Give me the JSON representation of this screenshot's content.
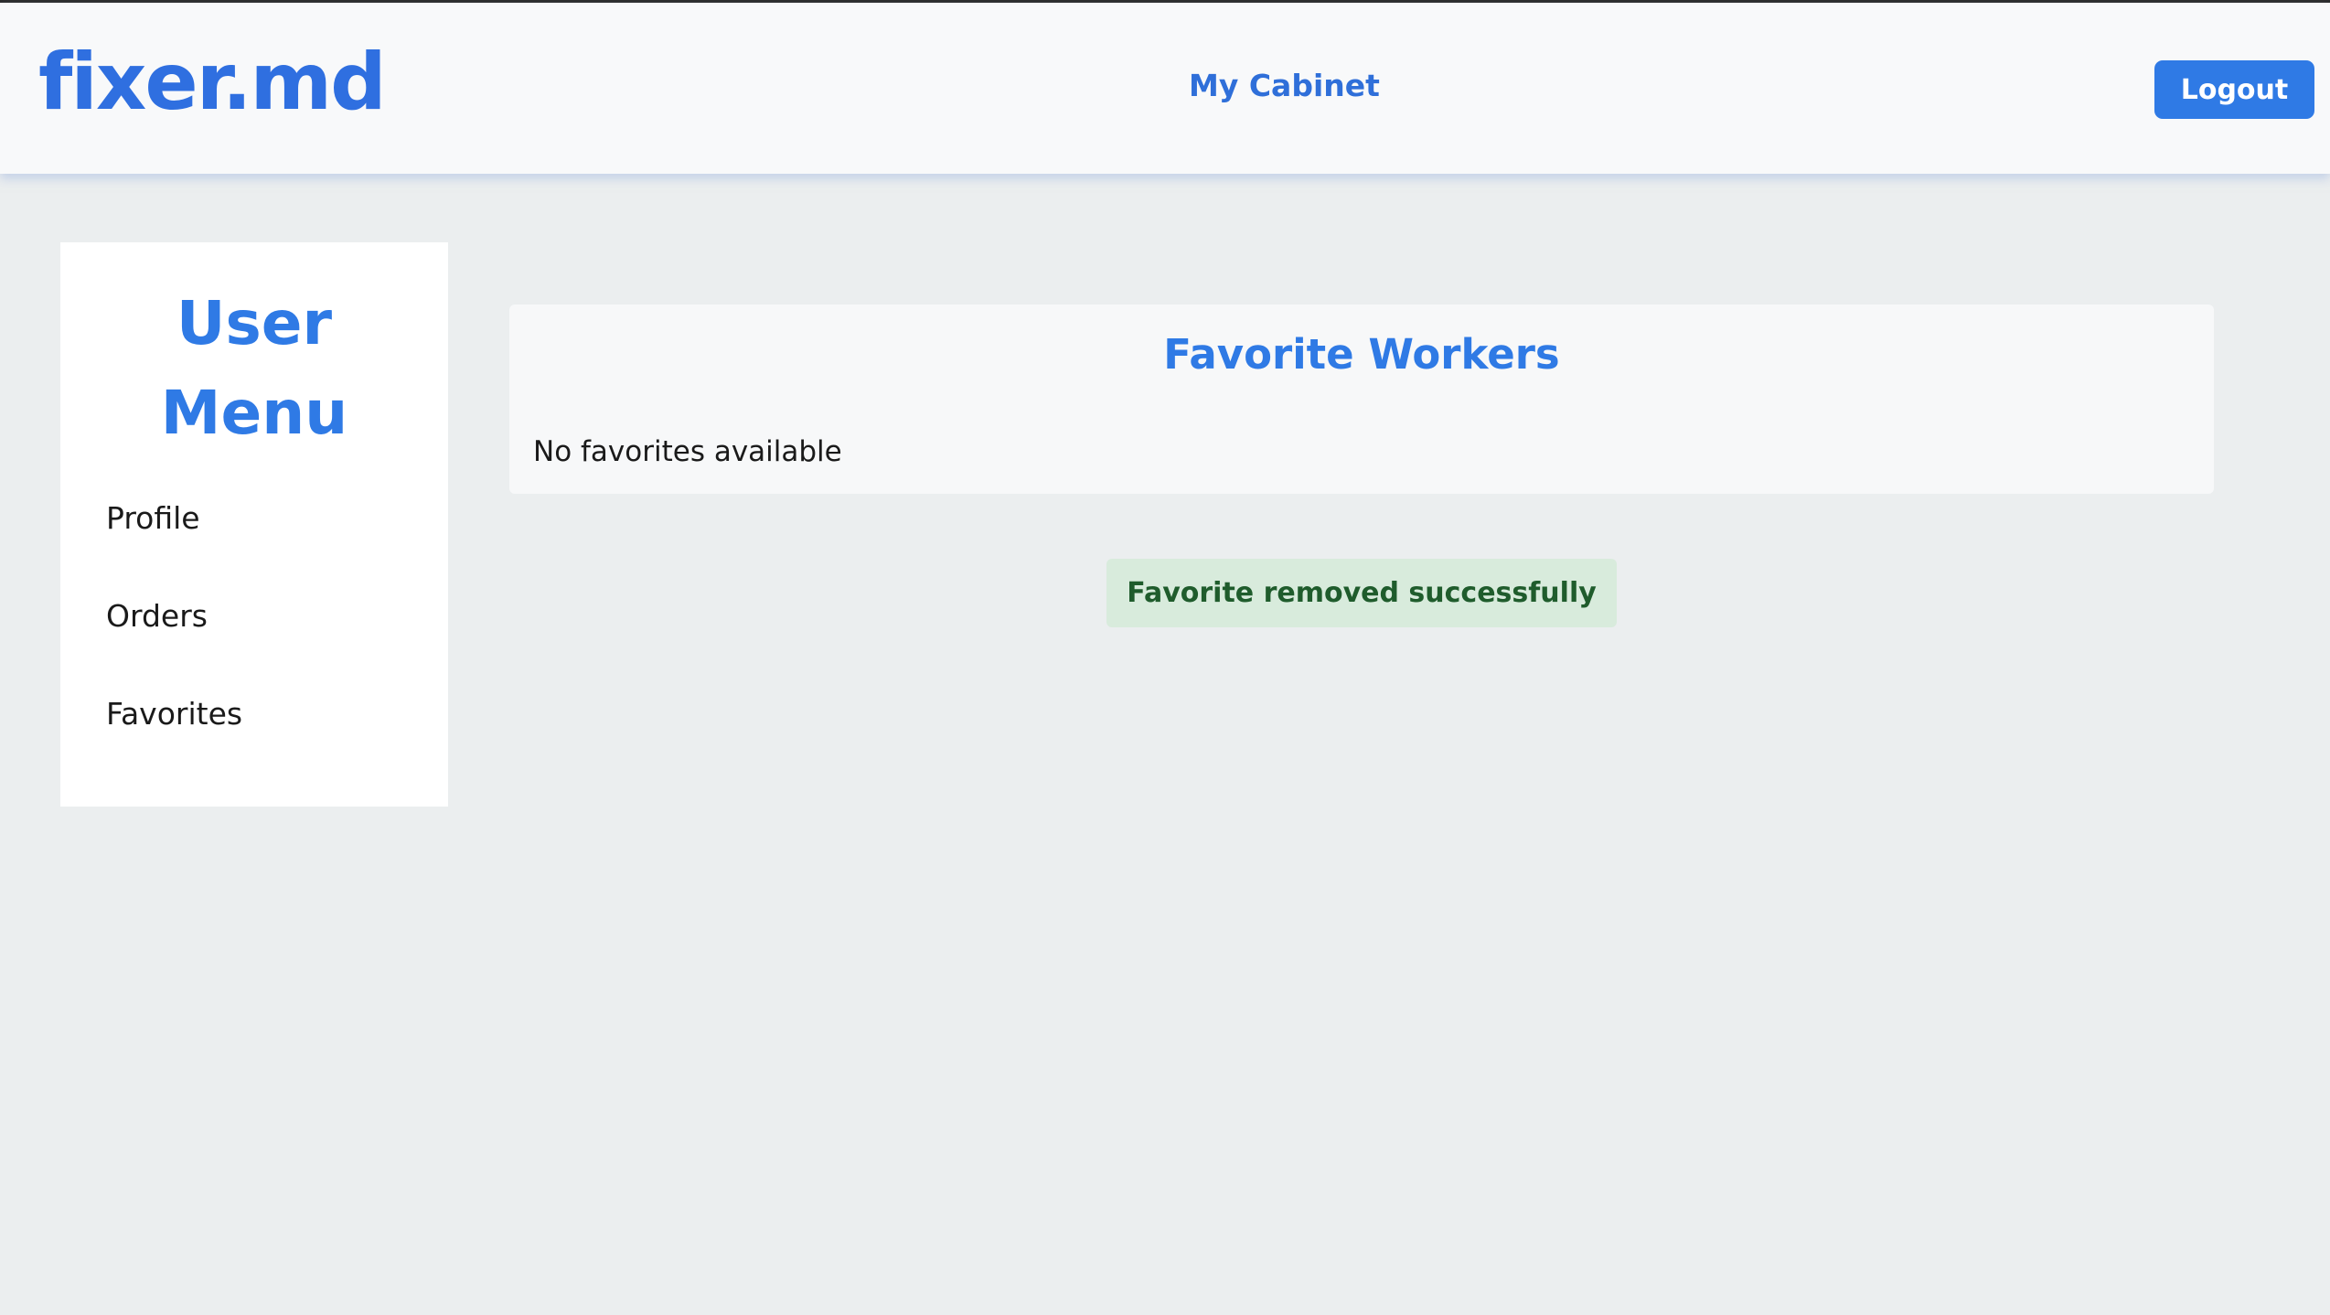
{
  "header": {
    "logo": "fixer.md",
    "title": "My Cabinet",
    "logout_label": "Logout"
  },
  "sidebar": {
    "title": "User\nMenu",
    "items": [
      {
        "label": "Profile"
      },
      {
        "label": "Orders"
      },
      {
        "label": "Favorites"
      }
    ]
  },
  "main": {
    "title": "Favorite Workers",
    "empty_message": "No favorites available"
  },
  "notification": {
    "message": "Favorite removed successfully",
    "type": "success"
  },
  "colors": {
    "accent": "#2f7ae5",
    "success_bg": "#d8ebdc",
    "success_text": "#1f5c2c",
    "page_bg": "#ebeeef"
  }
}
